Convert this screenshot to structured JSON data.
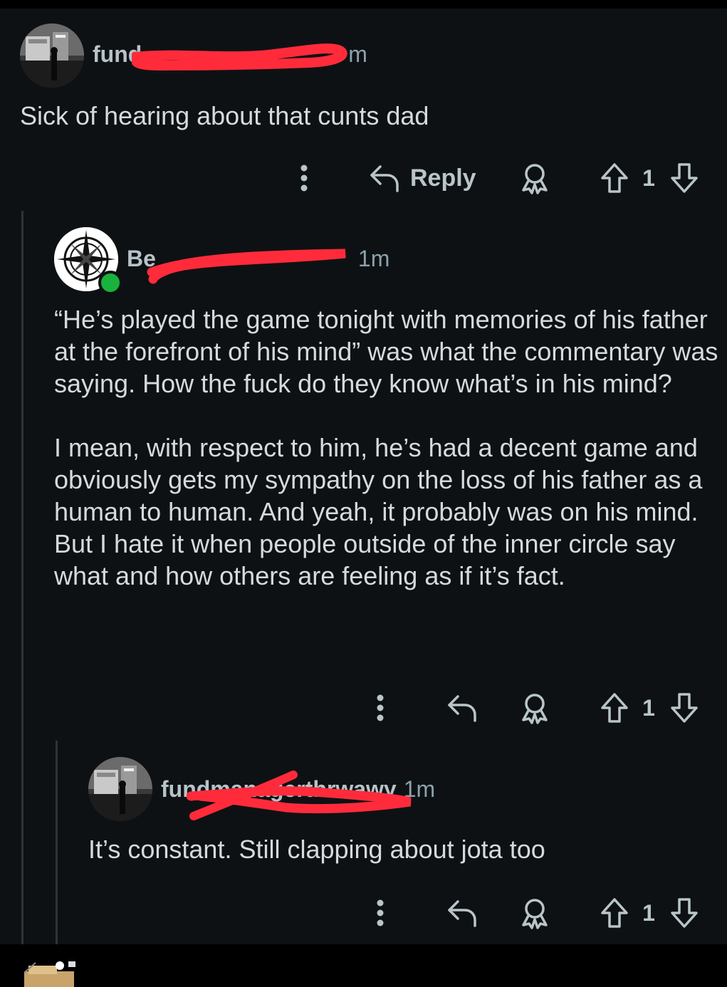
{
  "comments": [
    {
      "author": "fund",
      "author_tail": "m",
      "time": "",
      "body": [
        "Sick of hearing about that cunts dad"
      ],
      "actions": {
        "more_icon": "more-vertical-icon",
        "reply_label": "Reply",
        "award_icon": "award-icon",
        "upvote_icon": "arrow-up-icon",
        "vote_count": "1",
        "downvote_icon": "arrow-down-icon"
      }
    },
    {
      "author": "Be",
      "author_tail": "1m",
      "time": "",
      "online": true,
      "body": [
        "“He’s played the game tonight with memories of his father at the forefront of his mind” was what the commentary was saying. How the fuck do they know what’s in his mind?",
        "I mean, with respect to him, he’s had a decent game and obviously gets my sympathy on the loss of his father as a human to human. And yeah, it probably was on his mind. But I hate it when people outside of the inner circle say what and how others are feeling as if it’s fact."
      ],
      "actions": {
        "more_icon": "more-vertical-icon",
        "reply_icon": "reply-icon",
        "award_icon": "award-icon",
        "upvote_icon": "arrow-up-icon",
        "vote_count": "1",
        "downvote_icon": "arrow-down-icon"
      }
    },
    {
      "author": "fundmanagerthrwawy",
      "time": "1m",
      "body": [
        "It’s constant. Still clapping about jota too"
      ],
      "actions": {
        "more_icon": "more-vertical-icon",
        "reply_icon": "reply-icon",
        "award_icon": "award-icon",
        "upvote_icon": "arrow-up-icon",
        "vote_count": "1",
        "downvote_icon": "arrow-down-icon"
      }
    }
  ],
  "colors": {
    "background": "#0e1113",
    "text": "#d7dadc",
    "meta": "#8ba2ad",
    "icon": "#b8c5c9",
    "redaction": "#ff2b3b",
    "online": "#19b23c"
  }
}
